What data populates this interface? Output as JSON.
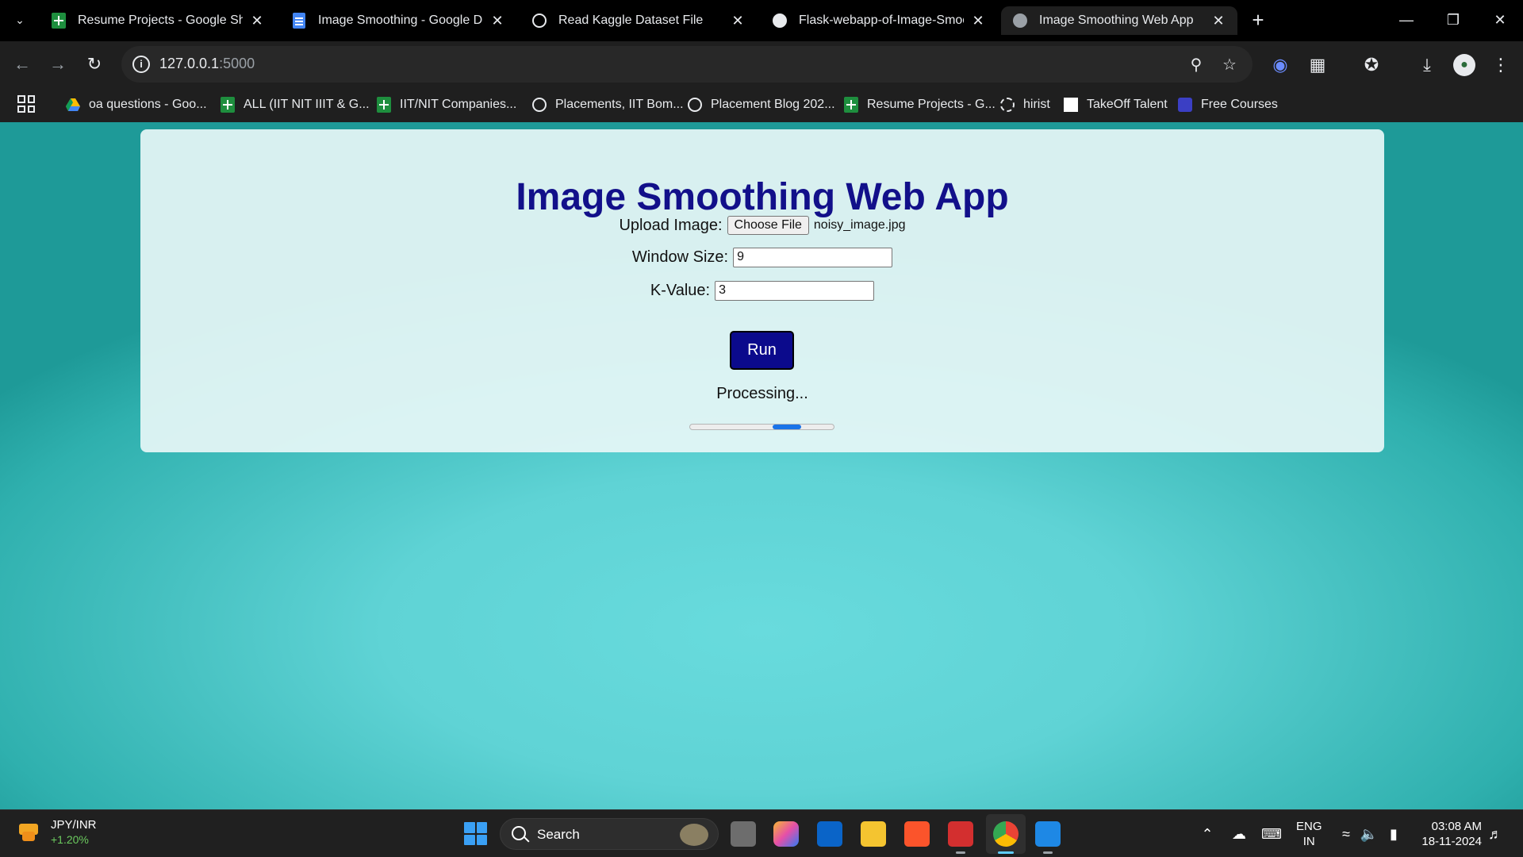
{
  "browser": {
    "tabs": [
      {
        "title": "Resume Projects - Google Sheets",
        "icon": "google-sheets-icon",
        "active": false
      },
      {
        "title": "Image Smoothing - Google Docs",
        "icon": "google-docs-icon",
        "active": false
      },
      {
        "title": "Read Kaggle Dataset File",
        "icon": "openai-icon",
        "active": false
      },
      {
        "title": "Flask-webapp-of-Image-Smoothing",
        "icon": "github-icon",
        "active": false
      },
      {
        "title": "Image Smoothing Web App",
        "icon": "globe-icon",
        "active": true
      }
    ],
    "address": {
      "host": "127.0.0.1",
      "port": ":5000"
    },
    "bookmarks": [
      {
        "label": "oa questions - Goo...",
        "icon": "google-drive-icon"
      },
      {
        "label": "ALL (IIT NIT IIIT & G...",
        "icon": "google-sheets-icon"
      },
      {
        "label": "IIT/NIT Companies...",
        "icon": "google-sheets-icon"
      },
      {
        "label": "Placements, IIT Bom...",
        "icon": "iitb-icon"
      },
      {
        "label": "Placement Blog 202...",
        "icon": "iitb-icon"
      },
      {
        "label": "Resume Projects - G...",
        "icon": "google-sheets-icon"
      },
      {
        "label": "hirist",
        "icon": "hirist-icon"
      },
      {
        "label": "TakeOff Talent",
        "icon": "takeoff-icon"
      },
      {
        "label": "Free Courses",
        "icon": "courses-icon"
      }
    ]
  },
  "app": {
    "title": "Image Smoothing Web App",
    "upload_label": "Upload Image:",
    "choose_file_label": "Choose File",
    "file_name": "noisy_image.jpg",
    "window_size_label": "Window Size:",
    "window_size_value": "9",
    "k_value_label": "K-Value:",
    "k_value_value": "3",
    "run_label": "Run",
    "status": "Processing...",
    "progress_indeterminate": true
  },
  "taskbar": {
    "widget_title": "JPY/INR",
    "widget_change": "+1.20%",
    "search_label": "Search",
    "lang_line1": "ENG",
    "lang_line2": "IN",
    "time": "03:08 AM",
    "date": "18-11-2024"
  },
  "colors": {
    "app_title": "#12108a",
    "run_button": "#0b0a8c",
    "background_teal": "#5fd3d5",
    "progress_fill": "#1a73e8"
  }
}
